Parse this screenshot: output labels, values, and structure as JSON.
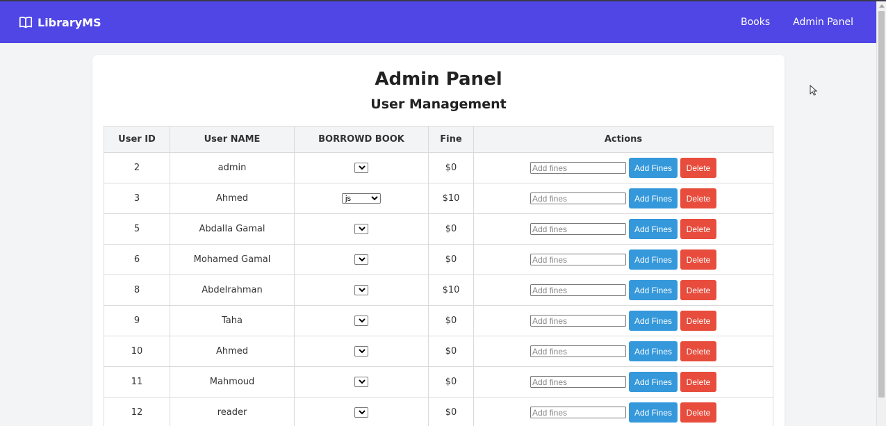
{
  "navbar": {
    "brand": "LibraryMS",
    "links": [
      {
        "label": "Books"
      },
      {
        "label": "Admin Panel"
      }
    ]
  },
  "main": {
    "title": "Admin Panel",
    "subtitle": "User Management",
    "table": {
      "headers": [
        "User ID",
        "User NAME",
        "BORROWD BOOK",
        "Fine",
        "Actions"
      ],
      "fines_placeholder": "Add fines",
      "add_label": "Add Fines",
      "delete_label": "Delete",
      "rows": [
        {
          "id": "2",
          "name": "admin",
          "book": "",
          "fine": "$0"
        },
        {
          "id": "3",
          "name": "Ahmed",
          "book": "js",
          "fine": "$10"
        },
        {
          "id": "5",
          "name": "Abdalla Gamal",
          "book": "",
          "fine": "$0"
        },
        {
          "id": "6",
          "name": "Mohamed Gamal",
          "book": "",
          "fine": "$0"
        },
        {
          "id": "8",
          "name": "Abdelrahman",
          "book": "",
          "fine": "$10"
        },
        {
          "id": "9",
          "name": "Taha",
          "book": "",
          "fine": "$0"
        },
        {
          "id": "10",
          "name": "Ahmed",
          "book": "",
          "fine": "$0"
        },
        {
          "id": "11",
          "name": "Mahmoud",
          "book": "",
          "fine": "$0"
        },
        {
          "id": "12",
          "name": "reader",
          "book": "",
          "fine": "$0"
        }
      ]
    }
  },
  "colors": {
    "navbar": "#4f46e5",
    "add_button": "#3498db",
    "delete_button": "#e74c3c"
  },
  "icons": {
    "brand": "open-book-icon"
  }
}
